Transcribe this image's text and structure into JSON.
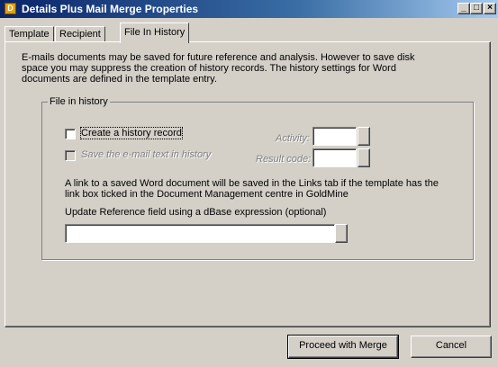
{
  "window": {
    "title": "Details Plus Mail Merge Properties",
    "app_icon": "dp-icon",
    "controls": {
      "minimize": "_",
      "maximize": "□",
      "close": "×"
    }
  },
  "tabs": [
    {
      "label": "Template",
      "active": false
    },
    {
      "label": "Recipient",
      "active": false
    },
    {
      "label": "File In History",
      "active": true
    }
  ],
  "intro_text": "E-mails documents may be saved for future reference and analysis. However to save disk space you may suppress the creation of history records. The history settings for Word documents are defined in the template entry.",
  "file_in_history": {
    "group_label": "File in history",
    "create_history": {
      "label": "Create a history record",
      "checked": false
    },
    "save_email_text": {
      "label": "Save the e-mail text in history",
      "checked": false,
      "enabled": false
    },
    "activity": {
      "label": "Activity:",
      "value": ""
    },
    "result_code": {
      "label": "Result code:",
      "value": ""
    },
    "note": "A link to a saved Word document will be saved in the Links tab if the template has the link box ticked in the Document Management centre in GoldMine",
    "update_label": "Update Reference field using a dBase expression (optional)",
    "update_value": ""
  },
  "buttons": {
    "proceed": "Proceed with Merge",
    "cancel": "Cancel"
  },
  "colors": {
    "titlebar_start": "#0a246a",
    "titlebar_end": "#a6caf0",
    "face": "#d4d0c8"
  }
}
